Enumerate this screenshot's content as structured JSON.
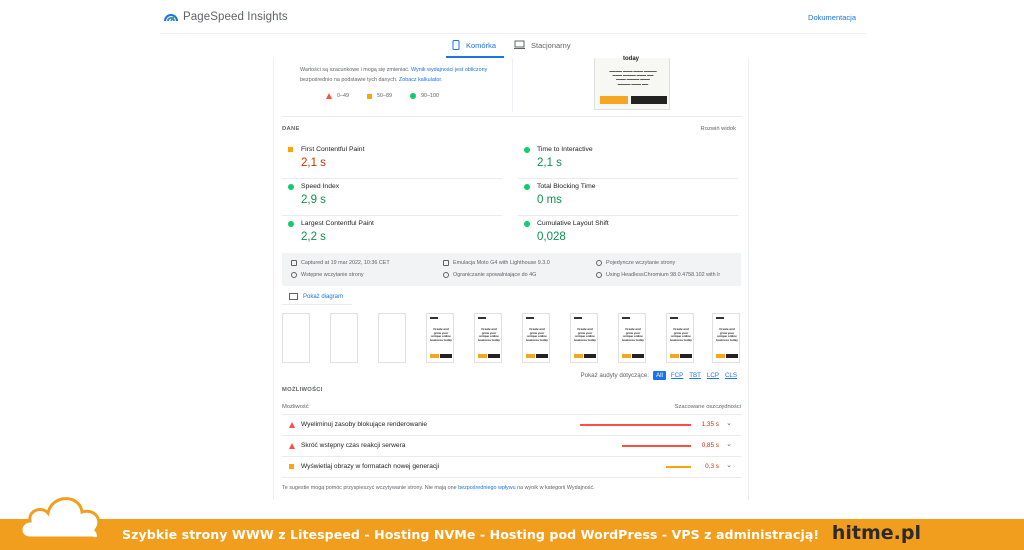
{
  "header": {
    "logo_text": "PageSpeed Insights",
    "doc_link": "Dokumentacja"
  },
  "tabs": [
    {
      "label": "Komórka",
      "icon": "mobile-icon",
      "active": true
    },
    {
      "label": "Stacjonarny",
      "icon": "desktop-icon",
      "active": false
    }
  ],
  "estimate": {
    "text_before": "Wartości są szacunkowe i mogą się zmieniać. ",
    "link1": "Wynik wydajności jest obliczony",
    "text_middle": " bezpośrednio na podstawie tych danych. ",
    "link2": "Zobacz kalkulator",
    "text_after": "."
  },
  "legend": [
    {
      "shape": "triangle",
      "range": "0–49",
      "color": "#ff4e42"
    },
    {
      "shape": "square",
      "range": "50–89",
      "color": "#ffa400"
    },
    {
      "shape": "circle",
      "range": "90–100",
      "color": "#0cce6b"
    }
  ],
  "screenshot_thumb": {
    "heading": "today"
  },
  "dane": {
    "label": "DANE",
    "expand_link": "Rozwiń widok"
  },
  "metrics": [
    {
      "name": "First Contentful Paint",
      "value": "2,1 s",
      "status": "average"
    },
    {
      "name": "Time to Interactive",
      "value": "2,1 s",
      "status": "pass"
    },
    {
      "name": "Speed Index",
      "value": "2,9 s",
      "status": "pass"
    },
    {
      "name": "Total Blocking Time",
      "value": "0 ms",
      "status": "pass"
    },
    {
      "name": "Largest Contentful Paint",
      "value": "2,2 s",
      "status": "pass"
    },
    {
      "name": "Cumulative Layout Shift",
      "value": "0,028",
      "status": "pass"
    }
  ],
  "run_info": [
    {
      "icon": "calendar-icon",
      "text": "Captured at 19 mar 2022, 10:36 CET"
    },
    {
      "icon": "device-icon",
      "text": "Emulacja Moto G4 with Lighthouse 9.3.0"
    },
    {
      "icon": "user-icon",
      "text": "Pojedyncze wczytanie strony"
    },
    {
      "icon": "timer-icon",
      "text": "Wstępne wczytanie strony"
    },
    {
      "icon": "wifi-icon",
      "text": "Ograniczanie spowalniające do 4G"
    },
    {
      "icon": "globe-icon",
      "text": "Using HeadlessChromium 98.0.4758.102 with lr"
    }
  ],
  "diagram_link": "Pokaż diagram",
  "filmstrip": {
    "frames_blank": 3,
    "frames_filled": 7,
    "frame_heading": "Create and grow your unique online business today"
  },
  "audit_filter": {
    "label": "Pokaż audyty dotyczące:",
    "chips": [
      "All",
      "FCP",
      "TBT",
      "LCP",
      "CLS"
    ]
  },
  "opportunities": {
    "label": "MOŻLIWOŚCI",
    "col_left": "Możliwość",
    "col_right": "Szacowane oszczędności",
    "items": [
      {
        "name": "Wyeliminuj zasoby blokujące renderowanie",
        "value": "1,35 s",
        "status": "fail",
        "bar_fraction": 0.99
      },
      {
        "name": "Skróć wstępny czas reakcji serwera",
        "value": "0,85 s",
        "status": "fail",
        "bar_fraction": 0.62
      },
      {
        "name": "Wyświetlaj obrazy w formatach nowej generacji",
        "value": "0,3 s",
        "status": "average",
        "bar_fraction": 0.22
      }
    ]
  },
  "footnote": {
    "before": "Te sugestie mogą pomóc przyspieszyć wczytywanie strony. Nie mają one ",
    "link": "bezpośredniego wpływu",
    "after": " na wynik w kategorii Wydajność."
  },
  "banner": {
    "text": "Szybkie strony WWW z Litespeed - Hosting  NVMe - Hosting pod WordPress - VPS z administracją!",
    "brand": "hitme.pl",
    "color": "#f19e1e"
  },
  "colors": {
    "accent": "#1a73e8",
    "fail": "#ff4e42",
    "average": "#ffa400",
    "pass": "#0cce6b"
  }
}
